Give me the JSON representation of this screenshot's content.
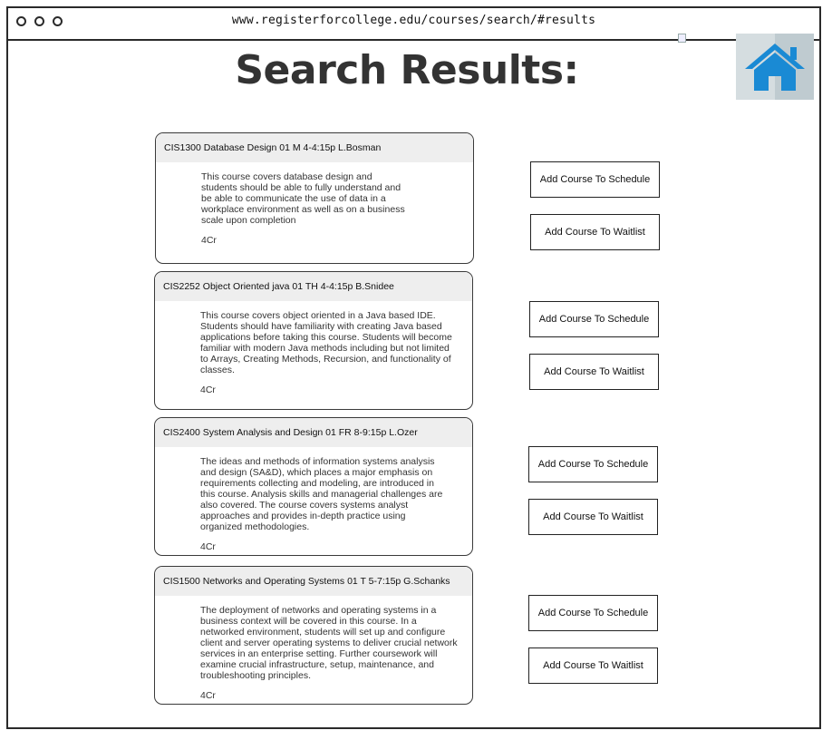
{
  "browser": {
    "url": "www.registerforcollege.edu/courses/search/#results"
  },
  "header": {
    "title": "Search Results:"
  },
  "actions": {
    "schedule_label": "Add Course To Schedule",
    "waitlist_label": "Add Course To Waitlist"
  },
  "courses": [
    {
      "header": "CIS1300 Database Design 01 M 4-4:15p L.Bosman",
      "description": "This course covers database design and students should be able to fully understand and be able to communicate the use of data in a workplace environment as well as on a business scale upon completion",
      "credits": "4Cr"
    },
    {
      "header": "CIS2252 Object Oriented java 01 TH 4-4:15p B.Snidee",
      "description": "This course covers object oriented in a Java based IDE. Students should have familiarity with creating Java based applications before taking this course. Students will become familiar with modern Java methods including but not limited to Arrays, Creating Methods, Recursion, and functionality of classes.",
      "credits": "4Cr"
    },
    {
      "header": "CIS2400 System Analysis and Design 01 FR 8-9:15p L.Ozer",
      "description": " The ideas and methods of information systems analysis and design (SA&D), which places a major emphasis on requirements collecting and modeling, are introduced in this course. Analysis skills and managerial challenges are also covered. The course covers systems analyst approaches and provides in-depth practice using organized methodologies.",
      "credits": "4Cr"
    },
    {
      "header": "CIS1500 Networks and Operating Systems 01 T 5-7:15p G.Schanks",
      "description": "The deployment of networks and operating systems in a business context will be covered in this course. In a networked environment, students will set up and configure client and server operating systems to deliver crucial network services in an enterprise setting. Further coursework will examine crucial infrastructure, setup, maintenance, and troubleshooting principles.",
      "credits": "4Cr"
    }
  ],
  "colors": {
    "home_icon": "#1a8ad4",
    "card_header_bg": "#eeeeee"
  },
  "icons": {
    "home": "home-icon",
    "window_controls": "window-control-dot"
  }
}
